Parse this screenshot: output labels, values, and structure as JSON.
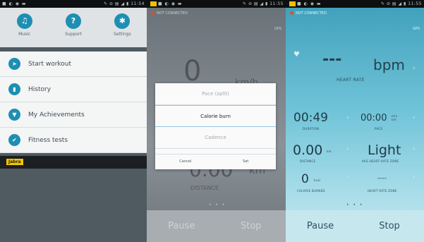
{
  "panel1": {
    "statusbar": {
      "left": "■ ◐ ◉ ▬",
      "right": "✎ ⊘ ▤ ◢ ▮ 11:54"
    },
    "quick_settings": [
      {
        "label": "Music",
        "icon": "headphones-icon",
        "glyph": "♫"
      },
      {
        "label": "Support",
        "icon": "question-icon",
        "glyph": "?"
      },
      {
        "label": "Settings",
        "icon": "gear-icon",
        "glyph": "✱"
      }
    ],
    "menu": [
      {
        "label": "Start workout",
        "icon": "runner-icon",
        "glyph": "➤"
      },
      {
        "label": "History",
        "icon": "chart-icon",
        "glyph": "▮"
      },
      {
        "label": "My Achievements",
        "icon": "trophy-icon",
        "glyph": "▼"
      },
      {
        "label": "Fitness tests",
        "icon": "check-icon",
        "glyph": "✔"
      }
    ],
    "brand": "Jabra"
  },
  "panel2": {
    "statusbar": {
      "left": "■ ◐ ◉ ▬",
      "right": "✎ ⊘ ▤ ◢ ▮ 11:55"
    },
    "top_status": "NOT CONNECTED",
    "gps": "GPS",
    "speed_value": "0",
    "speed_unit": "km/h",
    "distance_value": "0.00",
    "distance_unit": "km",
    "distance_label": "DISTANCE",
    "dialog": {
      "options": [
        "Pace (split)",
        "Calorie burn",
        "Cadence"
      ],
      "selected_index": 1,
      "cancel": "Cancel",
      "set": "Set"
    },
    "page_dots": "• • •",
    "pause": "Pause",
    "stop": "Stop"
  },
  "panel3": {
    "statusbar": {
      "left": "■ ◐ ◉ ▬",
      "right": "✎ ⊘ ▤ ◢ ▮ 11:55"
    },
    "top_status": "NOT CONNECTED",
    "gps": "GPS",
    "heart_value": "---",
    "heart_unit": "bpm",
    "heart_label": "HEART RATE",
    "duration_value": "00:49",
    "duration_label": "DURATION",
    "pace_value": "00:00",
    "pace_unit": "min km",
    "pace_label": "PACE",
    "distance_value": "0.00",
    "distance_unit": "km",
    "distance_label": "DISTANCE",
    "zone_value": "Light",
    "zone_label": "AVG HEART RATE ZONE",
    "calories_value": "0",
    "calories_unit": "kcal",
    "calories_label": "CALORIE BURNED",
    "hrzone_value": "----",
    "hrzone_label": "HEART RATE ZONE",
    "page_dots": "• • •",
    "pause": "Pause",
    "stop": "Stop"
  }
}
